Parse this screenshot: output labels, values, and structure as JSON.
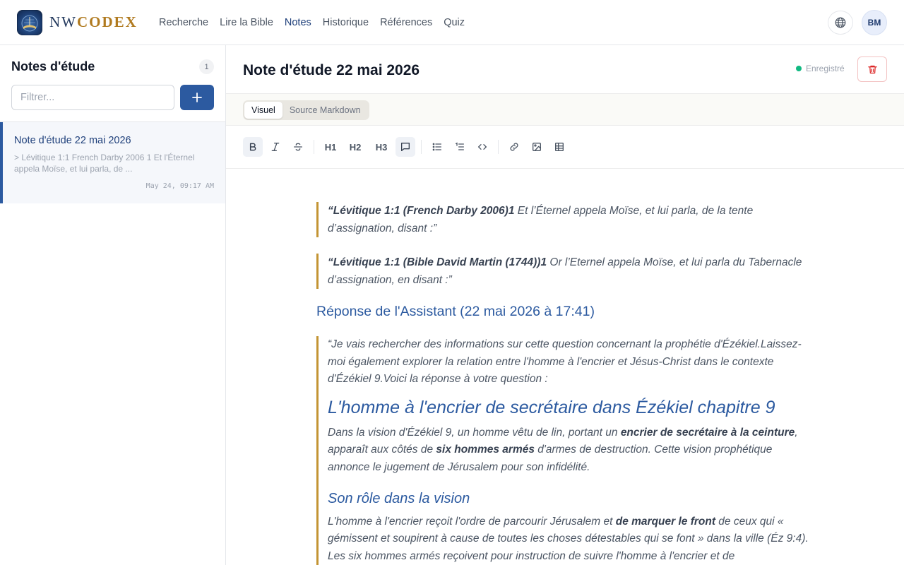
{
  "brand": {
    "nw": "NW",
    "codex": "CODEX"
  },
  "nav": [
    {
      "label": "Recherche",
      "active": false
    },
    {
      "label": "Lire la Bible",
      "active": false
    },
    {
      "label": "Notes",
      "active": true
    },
    {
      "label": "Historique",
      "active": false
    },
    {
      "label": "Références",
      "active": false
    },
    {
      "label": "Quiz",
      "active": false
    }
  ],
  "user": {
    "initials": "BM"
  },
  "sidebar": {
    "title": "Notes d'étude",
    "count": "1",
    "filter_placeholder": "Filtrer...",
    "add_label": "+",
    "notes": [
      {
        "title": "Note d'étude 22 mai 2026",
        "preview": "> Lévitique 1:1 French Darby 2006 1 Et l'Éternel appela Moïse, et lui parla, de ...",
        "date": "May 24, 09:17 AM"
      }
    ]
  },
  "doc": {
    "title": "Note d'étude 22 mai 2026",
    "status": "Enregistré",
    "modes": {
      "visual": "Visuel",
      "source": "Source Markdown"
    },
    "toolbar": {
      "h1": "H1",
      "h2": "H2",
      "h3": "H3"
    }
  },
  "content": {
    "quote1": {
      "ref": "“Lévitique 1:1 (French Darby 2006)1",
      "text": " Et l’Éternel appela Moïse, et lui parla, de la tente d’assignation, disant :”"
    },
    "quote2": {
      "ref": "“Lévitique 1:1 (Bible David Martin (1744))1",
      "text": " Or l’Eternel appela Moïse, et lui parla du Tabernacle d’assignation, en disant :”"
    },
    "assistant_heading": "Réponse de l'Assistant (22 mai 2026 à 17:41)",
    "intro": "“Je vais rechercher des informations sur cette question concernant la prophétie d'Ézékiel.Laissez-moi également explorer la relation entre l'homme à l'encrier et Jésus-Christ dans le contexte d'Ézékiel 9.Voici la réponse à votre question :",
    "h1": "L'homme à l'encrier de secrétaire dans Ézékiel chapitre 9",
    "p1": {
      "a": "Dans la vision d'Ézékiel 9, un homme vêtu de lin, portant un ",
      "b": "encrier de secrétaire à la ceinture",
      "c": ", apparaît aux côtés de ",
      "d": "six hommes armés",
      "e": " d'armes de destruction. Cette vision prophétique annonce le jugement de Jérusalem pour son infidélité."
    },
    "h2": "Son rôle dans la vision",
    "p2": {
      "a": "L'homme à l'encrier reçoit l'ordre de parcourir Jérusalem et ",
      "b": "de marquer le front",
      "c": " de ceux qui « gémissent et soupirent à cause de toutes les choses détestables qui se font » dans la ville (Éz 9:4). Les six hommes armés reçoivent pour instruction de suivre l'homme à l'encrier et de"
    }
  },
  "colors": {
    "accent": "#2c5aa0",
    "quote_border": "#c39433",
    "saved_dot": "#10b981",
    "brand_gold": "#b07a1f"
  }
}
